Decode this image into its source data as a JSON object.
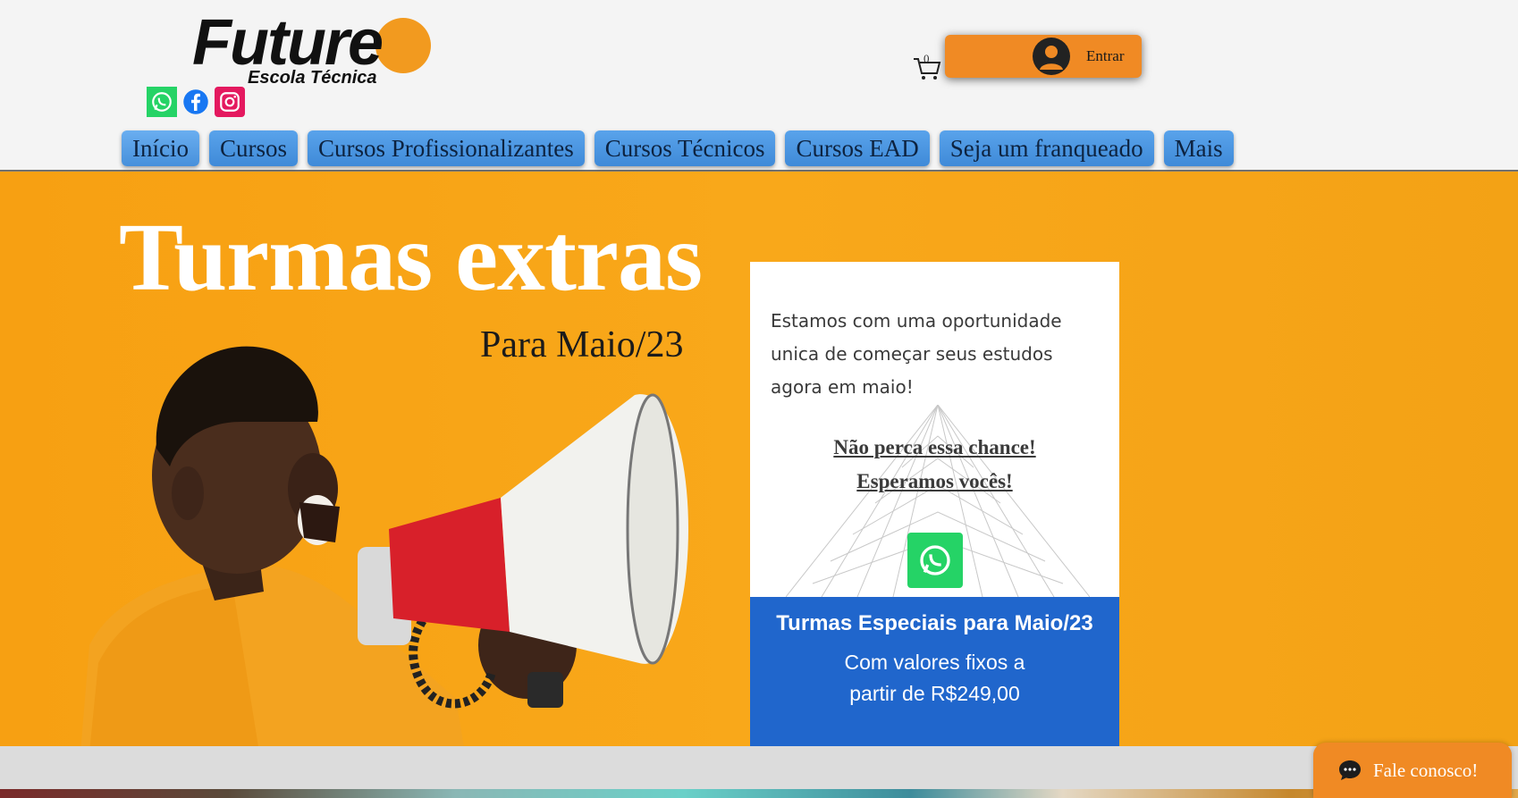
{
  "header": {
    "logo": {
      "word": "Future",
      "tagline": "Escola Técnica"
    },
    "social": [
      {
        "name": "whatsapp-icon"
      },
      {
        "name": "facebook-icon"
      },
      {
        "name": "instagram-icon"
      }
    ],
    "cart": {
      "count": "0"
    },
    "login": {
      "label": "Entrar"
    }
  },
  "nav": {
    "items": [
      {
        "label": "Início"
      },
      {
        "label": "Cursos"
      },
      {
        "label": "Cursos Profissionalizantes"
      },
      {
        "label": "Cursos Técnicos"
      },
      {
        "label": "Cursos EAD"
      },
      {
        "label": "Seja um franqueado"
      },
      {
        "label": "Mais"
      }
    ]
  },
  "hero": {
    "title": "Turmas extras",
    "subtitle": "Para Maio/23"
  },
  "card": {
    "text": "Estamos com uma oportunidade unica de começar seus estudos agora em maio!",
    "emphasis_1": "Não perca essa chance!",
    "emphasis_2": "Esperamos vocês!",
    "blue_title": "Turmas Especiais para Maio/23",
    "blue_line_1": "Com valores fixos a",
    "blue_line_2": "partir de R$249,00"
  },
  "chat": {
    "label": "Fale conosco!"
  },
  "colors": {
    "accent_orange": "#f08a24",
    "hero_orange": "#f9a81a",
    "nav_blue": "#4790db",
    "card_blue": "#2066cc",
    "whatsapp_green": "#25d366"
  }
}
